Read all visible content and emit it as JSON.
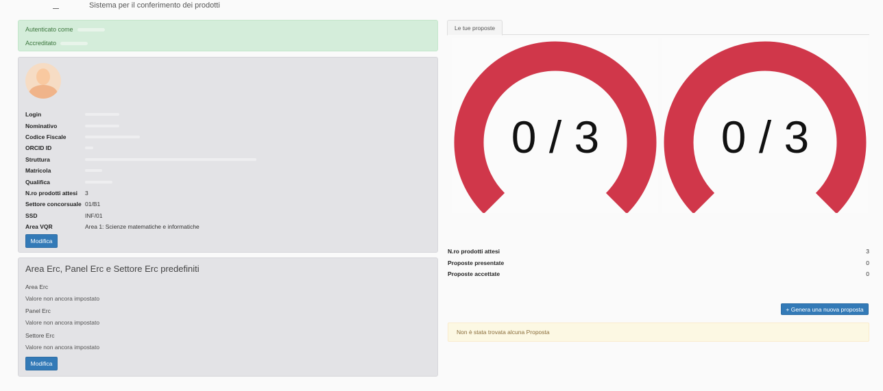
{
  "header": {
    "subtitle": "Sistema per il conferimento dei prodotti"
  },
  "auth": {
    "authenticated_label": "Autenticato come",
    "accredited_label": "Accreditato"
  },
  "profile": {
    "fields": [
      {
        "label": "Login",
        "value": ""
      },
      {
        "label": "Nominativo",
        "value": ""
      },
      {
        "label": "Codice Fiscale",
        "value": ""
      },
      {
        "label": "ORCID ID",
        "value": ""
      },
      {
        "label": "Struttura",
        "value": ""
      },
      {
        "label": "Matricola",
        "value": ""
      },
      {
        "label": "Qualifica",
        "value": ""
      },
      {
        "label": "N.ro prodotti attesi",
        "value": "3"
      },
      {
        "label": "Settore concorsuale",
        "value": "01/B1"
      },
      {
        "label": "SSD",
        "value": "INF/01"
      },
      {
        "label": "Area VQR",
        "value": "Area 1: Scienze matematiche e informatiche"
      }
    ],
    "edit_button": "Modifica"
  },
  "erc": {
    "title": "Area Erc, Panel Erc e Settore Erc predefiniti",
    "items": [
      {
        "label": "Area Erc",
        "value": "Valore non ancora impostato"
      },
      {
        "label": "Panel Erc",
        "value": "Valore non ancora impostato"
      },
      {
        "label": "Settore Erc",
        "value": "Valore non ancora impostato"
      }
    ],
    "edit_button": "Modifica"
  },
  "proposals": {
    "tab_label": "Le tue proposte",
    "gauges": [
      {
        "text": "0 / 3",
        "value": 0,
        "max": 3
      },
      {
        "text": "0 / 3",
        "value": 0,
        "max": 3
      }
    ],
    "summary": [
      {
        "label": "N.ro prodotti attesi",
        "value": "3"
      },
      {
        "label": "Proposte presentate",
        "value": "0"
      },
      {
        "label": "Proposte accettate",
        "value": "0"
      }
    ],
    "new_button": "+ Genera una nuova proposta",
    "empty_message": "Non è stata trovata alcuna Proposta"
  },
  "colors": {
    "gauge_red": "#d0374a",
    "primary_blue": "#337ab7",
    "success_bg": "#d4edda",
    "warning_bg": "#fcf8e3"
  }
}
